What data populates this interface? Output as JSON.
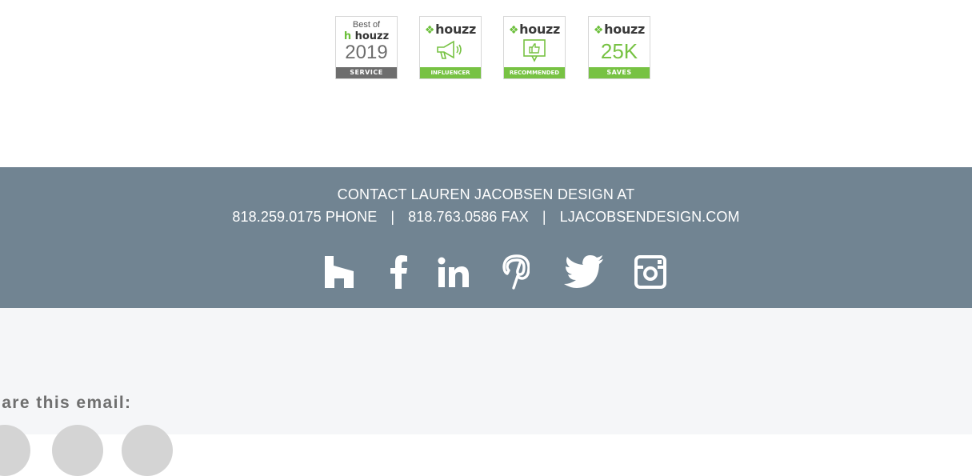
{
  "badges": {
    "best": {
      "top_text": "Best of",
      "brand": "houzz",
      "year": "2019",
      "strip": "SERVICE"
    },
    "influencer": {
      "brand": "houzz",
      "icon": "megaphone-icon",
      "strip": "INFLUENCER"
    },
    "recommended": {
      "brand": "houzz",
      "icon": "thumbs-up-icon",
      "strip": "RECOMMENDED"
    },
    "saves": {
      "brand": "houzz",
      "count": "25K",
      "strip": "SAVES"
    }
  },
  "contact": {
    "heading": "CONTACT LAUREN JACOBSEN DESIGN AT",
    "phone": "818.259.0175 PHONE",
    "separator": "|",
    "fax": "818.763.0586 FAX",
    "website": "LJACOBSENDESIGN.COM"
  },
  "social": {
    "icons": [
      "houzz-icon",
      "facebook-icon",
      "linkedin-icon",
      "pinterest-icon",
      "twitter-icon",
      "instagram-icon"
    ]
  },
  "share": {
    "label": "hare this email:",
    "buttons": [
      "share-button-1",
      "share-button-2",
      "share-button-3"
    ]
  },
  "colors": {
    "contact_bg": "#718492",
    "share_bg": "#f5f6f8",
    "houzz_green": "#77c243",
    "badge_grey": "#6d6d6d"
  }
}
